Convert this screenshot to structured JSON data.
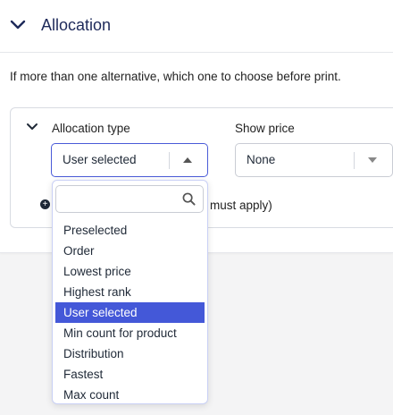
{
  "section": {
    "title": "Allocation",
    "description": "If more than one alternative, which one to choose before print."
  },
  "rule": {
    "allocation_type_label": "Allocation type",
    "allocation_type_value": "User selected",
    "show_price_label": "Show price",
    "show_price_value": "None",
    "hint_visible_text": "must apply)"
  },
  "dropdown": {
    "search_placeholder": "",
    "options": [
      "Preselected",
      "Order",
      "Lowest price",
      "Highest rank",
      "User selected",
      "Min count for product",
      "Distribution",
      "Fastest",
      "Max count"
    ],
    "selected": "User selected"
  },
  "icons": {
    "section_toggle": "chevron-down-icon",
    "rule_toggle": "chevron-down-icon",
    "allocation_arrow": "caret-up-icon",
    "price_arrow": "caret-down-icon",
    "search": "search-icon",
    "add": "plus-circle-icon"
  },
  "colors": {
    "accent": "#4458d8",
    "title": "#1e2a5a",
    "border": "#c9ccd4"
  }
}
